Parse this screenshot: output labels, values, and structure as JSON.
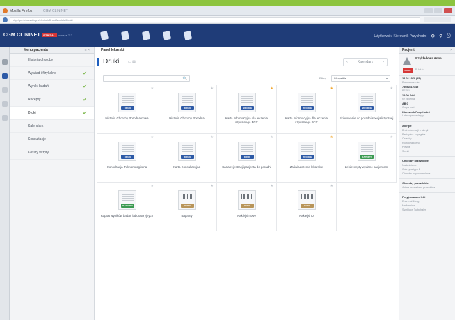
{
  "browser": {
    "app_title": "Mozilla Firefox",
    "tab_text": "CGM CLININET",
    "url": "http://pc-lekarski/cgm/clininet/Druki/Module/Druki"
  },
  "header": {
    "brand": "CGM CLININET",
    "brand_badge": "SZPITAL",
    "version": "wersja 7.2",
    "user_text": "Użytkownik: Kierownik Przychodni",
    "help": "?",
    "search_icon": "search-icon"
  },
  "leftpanel": {
    "title": "Menu pacjenta",
    "controls": "≡ ×",
    "items": [
      {
        "label": "Historia choroby",
        "check": ""
      },
      {
        "label": "Wywiad i fizykalne",
        "check": "✔"
      },
      {
        "label": "Wyniki badań",
        "check": "✔"
      },
      {
        "label": "Recepty",
        "check": "✔"
      },
      {
        "label": "Druki",
        "check": "✔"
      },
      {
        "label": "Kalendarz",
        "check": ""
      },
      {
        "label": "Konsultacje",
        "check": ""
      },
      {
        "label": "Koszty wizyty",
        "check": ""
      }
    ]
  },
  "main": {
    "breadcrumb": "Panel lekarski",
    "title": "Druki",
    "title_controls": "▭ ▤",
    "pager": {
      "prev": "‹",
      "label": "Kalendarz",
      "next": "›"
    },
    "search": {
      "placeholder": "",
      "icon": "🔍"
    },
    "filter": {
      "label": "Filtruj",
      "value": "Wszystkie",
      "chevron": "▾"
    }
  },
  "cards": [
    {
      "name": "Historia Choroby Porodna nowa",
      "tag": "DRUKI",
      "tag_color": "#2d5aa6",
      "style": "lines",
      "fav": false
    },
    {
      "name": "Historia Choroby Porodna",
      "tag": "DRUKI",
      "tag_color": "#2d5aa6",
      "style": "lines",
      "fav": false
    },
    {
      "name": "Karta informacyjna dla leczenia szpitalnego PCC",
      "tag": "WZORCE",
      "tag_color": "#2d5aa6",
      "style": "lines",
      "fav": true
    },
    {
      "name": "Karta informacyjna dla leczenia szpitalnego PCC",
      "tag": "WZORCE",
      "tag_color": "#2d5aa6",
      "style": "lines",
      "fav": true
    },
    {
      "name": "Skierowanie do poradni specjalistycznej",
      "tag": "WZORCE",
      "tag_color": "#2d5aa6",
      "style": "lines",
      "fav": false
    },
    {
      "name": "Konsultacja Pulmonologiczna",
      "tag": "DRUKI",
      "tag_color": "#2d5aa6",
      "style": "lines",
      "fav": false
    },
    {
      "name": "Karta Konsultacyjna",
      "tag": "DRUKI",
      "tag_color": "#2d5aa6",
      "style": "lines",
      "fav": false
    },
    {
      "name": "Karta rejestracji pacjenta do poradni",
      "tag": "DRUKI",
      "tag_color": "#2d5aa6",
      "style": "lines",
      "fav": false
    },
    {
      "name": "Zaświadczenie lekarskie",
      "tag": "WZORCE",
      "tag_color": "#2d5aa6",
      "style": "lines",
      "fav": true
    },
    {
      "name": "Leki/recepty wydane pacjentom",
      "tag": "RAPORTY",
      "tag_color": "#3c9a52",
      "style": "lines",
      "fav": false
    },
    {
      "name": "Raport wyników badań laboratoryjnych",
      "tag": "RAPORTY",
      "tag_color": "#3c9a52",
      "style": "lines",
      "fav": false
    },
    {
      "name": "Bagamy",
      "tag": "KODY",
      "tag_color": "#b8955a",
      "style": "barcode",
      "fav": false
    },
    {
      "name": "Naklejki nowe",
      "tag": "KODY",
      "tag_color": "#b8955a",
      "style": "barcode",
      "fav": false
    },
    {
      "name": "Naklejki ID",
      "tag": "KODY",
      "tag_color": "#b8955a",
      "style": "barcode",
      "fav": false
    }
  ],
  "star_symbol": "★",
  "rightpanel": {
    "title": "Pacjent",
    "close": "×",
    "patient_name": "Przykładowa Anna",
    "badge": "RODO",
    "badge_text": "45 lat  ♀",
    "kv": [
      {
        "k": "28.08.1978 (45)",
        "v": "Data urodzenia"
      },
      {
        "k": "78082812345",
        "v": "PESEL"
      },
      {
        "k": "12:00 Fdd",
        "v": "Nr zlecenia"
      },
      {
        "k": "AB 0",
        "v": "Grupa krwi"
      },
      {
        "k": "Kierownik Przychodni",
        "v": "Lekarz prowadzący"
      }
    ],
    "sections": [
      {
        "h": "Alergie",
        "lines": [
          "Brak informacji o alergii",
          "Penicylina - wysypka",
          "Orzechy",
          "Roztocza kurzu",
          "Pleśnie",
          "Sierść"
        ]
      },
      {
        "h": "Choroby przewlekłe",
        "lines": [
          "Nadciśnienie",
          "Cukrzyca typu 2",
          "Choroba zwyrodnieniowa"
        ]
      },
      {
        "h": "Choroby przewlekłe",
        "lines": [
          "Astma oskrzelowa przewlekła"
        ]
      },
      {
        "h": "Przyjmowane leki",
        "lines": [
          "Enarenal 10mg",
          "Metformina",
          "Symbicort Turbuhaler"
        ]
      }
    ]
  }
}
